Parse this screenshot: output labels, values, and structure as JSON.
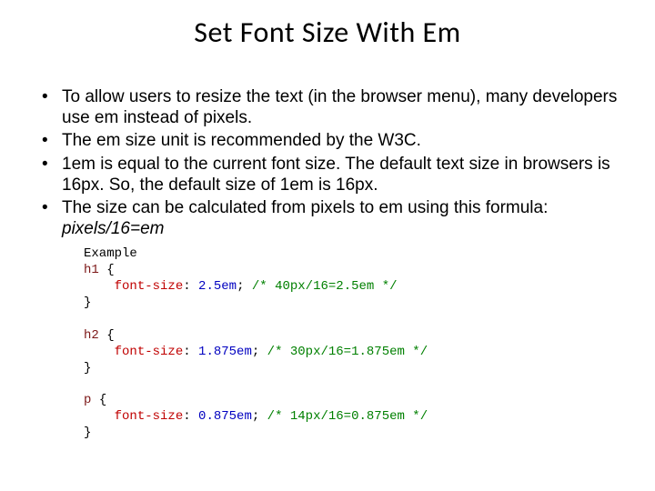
{
  "title": "Set Font Size With Em",
  "bullets": [
    "To allow users to resize the text (in the browser menu), many developers use em instead of pixels.",
    "The em size unit is recommended by the W3C.",
    "1em is equal to the current font size. The default text size in browsers is 16px. So, the default size of 1em is 16px.",
    "The size can be calculated from pixels to em using this formula: "
  ],
  "formula": "pixels/16=em",
  "example": {
    "label": "Example",
    "rules": [
      {
        "selector": "h1",
        "property": "font-size",
        "value": "2.5em",
        "comment": "/* 40px/16=2.5em */"
      },
      {
        "selector": "h2",
        "property": "font-size",
        "value": "1.875em",
        "comment": "/* 30px/16=1.875em */"
      },
      {
        "selector": "p",
        "property": "font-size",
        "value": "0.875em",
        "comment": "/* 14px/16=0.875em */"
      }
    ]
  }
}
